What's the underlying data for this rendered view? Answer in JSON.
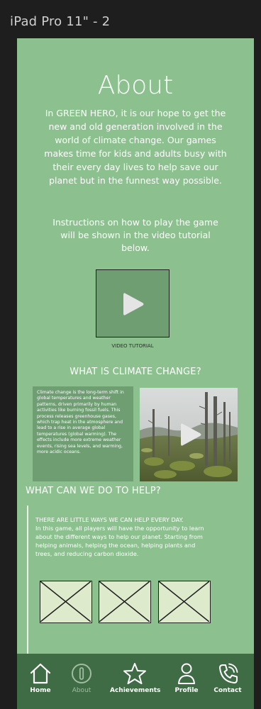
{
  "frame": {
    "label": "iPad Pro 11\" - 2"
  },
  "about": {
    "title": "About",
    "intro": "In GREEN HERO, it is our hope to get the new and old generation involved in the world of climate change. Our games makes time for kids and adults busy with their every day lives to help save our planet but in the funnest way possible.",
    "instructions": "Instructions on how to play the game will be shown in the video tutorial below."
  },
  "video": {
    "caption": "VIDEO TUTORIAL"
  },
  "climate": {
    "heading": "WHAT IS CLIMATE CHANGE?",
    "text": "Climate change is the long-term shift in global temperatures and weather patterns, driven primarily by human activities like burning fossil fuels. This process releases greenhouse gases, which trap heat in the atmosphere and lead to a rise in average global temperatures (global warming). The effects include more extreme weather events, rising sea levels, and warming, more acidic oceans."
  },
  "help": {
    "heading": "WHAT CAN WE DO TO HELP?",
    "lead": "THERE ARE LITTLE WAYS WE CAN HELP EVERY DAY.",
    "body": "In this game, all players will have the opportunity to learn about the different ways to help our planet. Starting from helping animals, helping the ocean, helping plants and trees, and reducing carbon dioxide."
  },
  "nav": {
    "items": [
      {
        "label": "Home",
        "icon": "home-icon"
      },
      {
        "label": "About",
        "icon": "info-icon"
      },
      {
        "label": "Achievements",
        "icon": "star-icon"
      },
      {
        "label": "Profile",
        "icon": "person-icon"
      },
      {
        "label": "Contact",
        "icon": "phone-icon"
      }
    ]
  },
  "colors": {
    "background": "#8cc08e",
    "panel": "#6e9e72",
    "navbar": "#3f6b45",
    "placeholder": "#ddeacb"
  }
}
